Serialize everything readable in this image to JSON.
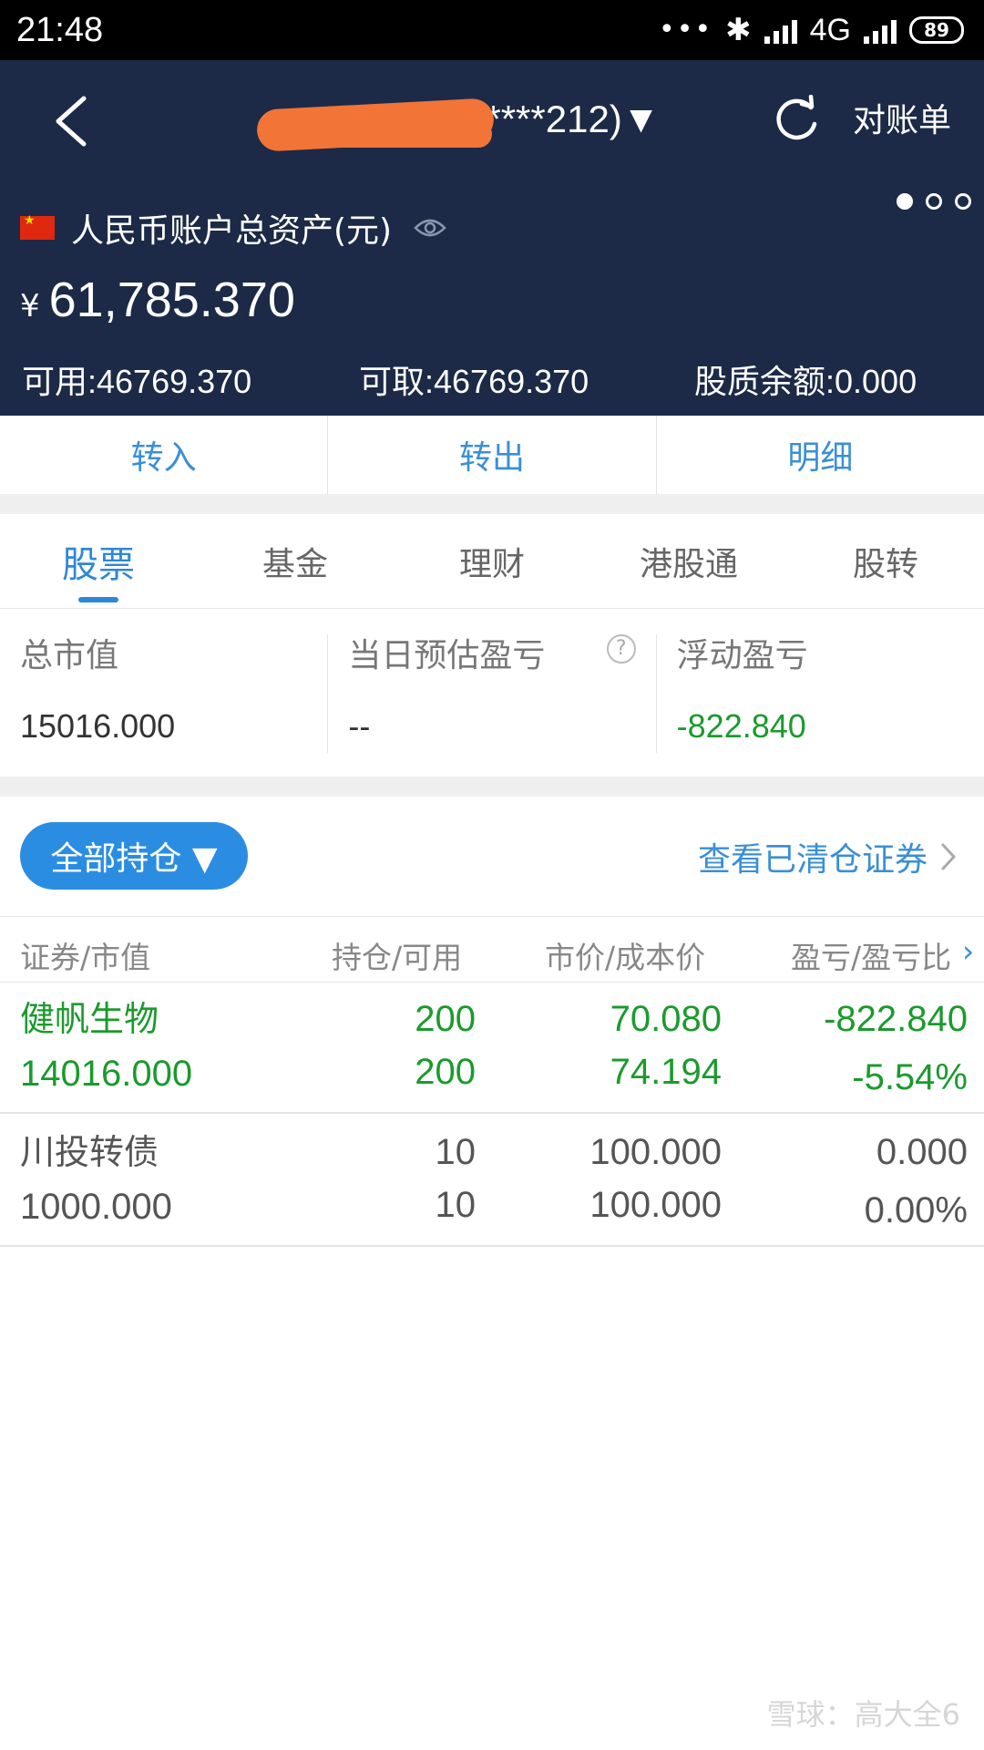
{
  "status_bar": {
    "time": "21:48",
    "dots": "•••",
    "network": "4G",
    "battery": "89"
  },
  "header": {
    "account_title": "5****212)▼",
    "statement": "对账单",
    "asset_label": "人民币账户总资产(元)",
    "currency": "¥",
    "total_assets": "61,785.370",
    "available": "可用:46769.370",
    "withdrawable": "可取:46769.370",
    "pledge_balance": "股质余额:0.000"
  },
  "actions": [
    "转入",
    "转出",
    "明细"
  ],
  "tabs": [
    "股票",
    "基金",
    "理财",
    "港股通",
    "股转"
  ],
  "summary": [
    {
      "label": "总市值",
      "value": "15016.000"
    },
    {
      "label": "当日预估盈亏",
      "value": "--",
      "help": "?"
    },
    {
      "label": "浮动盈亏",
      "value": "-822.840"
    }
  ],
  "filter": {
    "all_holdings": "全部持仓 ▼",
    "view_cleared": "查看已清仓证券"
  },
  "table": {
    "headers": [
      "证券/市值",
      "持仓/可用",
      "市价/成本价",
      "盈亏/盈亏比"
    ],
    "rows": [
      {
        "name": "健帆生物",
        "market_value": "14016.000",
        "position": "200",
        "available": "200",
        "price": "70.080",
        "cost": "74.194",
        "pnl": "-822.840",
        "pnl_pct": "-5.54%"
      },
      {
        "name": "川投转债",
        "market_value": "1000.000",
        "position": "10",
        "available": "10",
        "price": "100.000",
        "cost": "100.000",
        "pnl": "0.000",
        "pnl_pct": "0.00%"
      }
    ]
  },
  "watermark": "雪球：高大全6",
  "colors": {
    "header_bg": "#1c2a47",
    "accent": "#2f87d8",
    "loss_green": "#1b9a2d",
    "redaction": "#f27436"
  }
}
